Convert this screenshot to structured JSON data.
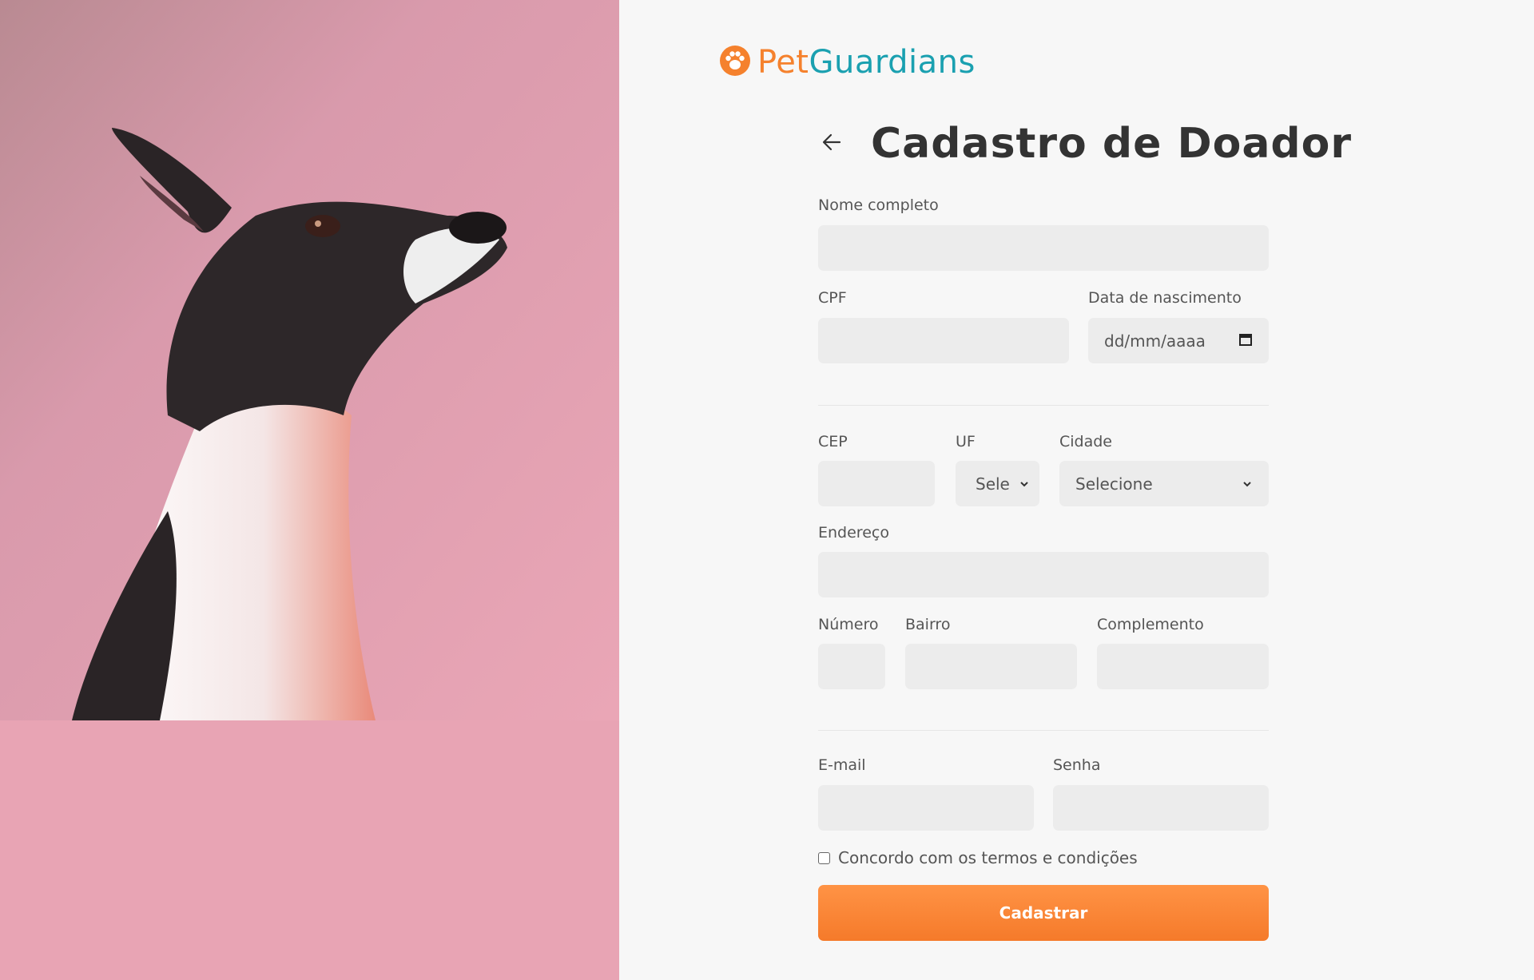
{
  "brand": {
    "pet": "Pet",
    "guardians": "Guardians",
    "logo_icon": "paw-icon"
  },
  "header": {
    "title": "Cadastro de Doador",
    "back_icon": "arrow-left-icon"
  },
  "form": {
    "nome": {
      "label": "Nome completo",
      "value": ""
    },
    "cpf": {
      "label": "CPF",
      "value": ""
    },
    "nascimento": {
      "label": "Data de nascimento",
      "placeholder": "dd/mm/aaaa"
    },
    "cep": {
      "label": "CEP",
      "value": ""
    },
    "uf": {
      "label": "UF",
      "selected": "Sele"
    },
    "cidade": {
      "label": "Cidade",
      "selected": "Selecione"
    },
    "endereco": {
      "label": "Endereço",
      "value": ""
    },
    "numero": {
      "label": "Número",
      "value": ""
    },
    "bairro": {
      "label": "Bairro",
      "value": ""
    },
    "complemento": {
      "label": "Complemento",
      "value": ""
    },
    "email": {
      "label": "E-mail",
      "value": ""
    },
    "senha": {
      "label": "Senha",
      "value": ""
    },
    "terms_label": "Concordo com os termos e condições",
    "terms_checked": false,
    "submit_label": "Cadastrar"
  },
  "colors": {
    "accent": "#f5812d",
    "brand_teal": "#1aa0b0",
    "photo_bg": "#e8a4b4"
  }
}
